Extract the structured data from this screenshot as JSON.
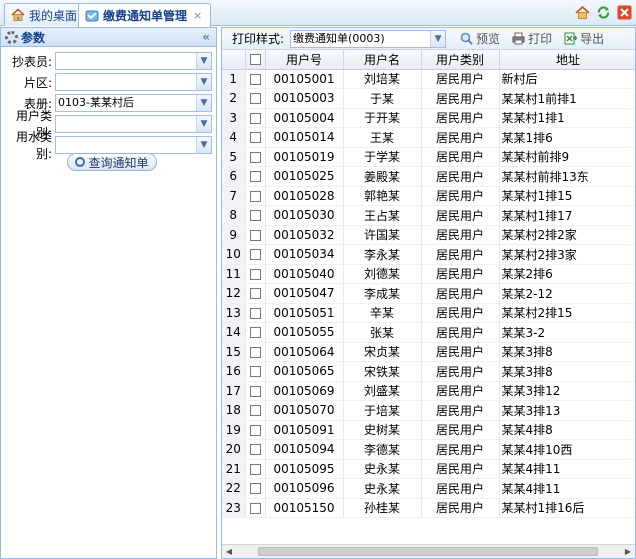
{
  "tabs": [
    {
      "label": "我的桌面",
      "active": false
    },
    {
      "label": "缴费通知单管理",
      "active": true,
      "close": "×"
    }
  ],
  "params": {
    "title": "参数",
    "fields": [
      {
        "label": "抄表员:",
        "value": ""
      },
      {
        "label": "片区:",
        "value": ""
      },
      {
        "label": "表册:",
        "value": "0103-某某村后"
      },
      {
        "label": "用户类别:",
        "value": ""
      },
      {
        "label": "用水类别:",
        "value": ""
      }
    ],
    "query_button": "查询通知单"
  },
  "toolbar": {
    "print_style_label": "打印样式:",
    "print_style_value": "缴费通知单(0003)",
    "preview": "预览",
    "print": "打印",
    "export": "导出"
  },
  "grid": {
    "columns": [
      "",
      "用户号",
      "用户名",
      "用户类别",
      "地址"
    ],
    "rows": [
      [
        "1",
        "00105001",
        "刘培某",
        "居民用户",
        "新村后"
      ],
      [
        "2",
        "00105003",
        "于某",
        "居民用户",
        "某某村1前排1"
      ],
      [
        "3",
        "00105004",
        "于开某",
        "居民用户",
        "某某村1排1"
      ],
      [
        "4",
        "00105014",
        "王某",
        "居民用户",
        "某某1排6"
      ],
      [
        "5",
        "00105019",
        "于学某",
        "居民用户",
        "某某村前排9"
      ],
      [
        "6",
        "00105025",
        "姜殿某",
        "居民用户",
        "某某村前排13东"
      ],
      [
        "7",
        "00105028",
        "郭艳某",
        "居民用户",
        "某某村1排15"
      ],
      [
        "8",
        "00105030",
        "王占某",
        "居民用户",
        "某某村1排17"
      ],
      [
        "9",
        "00105032",
        "许国某",
        "居民用户",
        "某某村2排2家"
      ],
      [
        "10",
        "00105034",
        "李永某",
        "居民用户",
        "某某村2排3家"
      ],
      [
        "11",
        "00105040",
        "刘德某",
        "居民用户",
        "某某2排6"
      ],
      [
        "12",
        "00105047",
        "李成某",
        "居民用户",
        "某某2-12"
      ],
      [
        "13",
        "00105051",
        "辛某",
        "居民用户",
        "某某村2排15"
      ],
      [
        "14",
        "00105055",
        "张某",
        "居民用户",
        "某某3-2"
      ],
      [
        "15",
        "00105064",
        "宋贞某",
        "居民用户",
        "某某3排8"
      ],
      [
        "16",
        "00105065",
        "宋铁某",
        "居民用户",
        "某某3排8"
      ],
      [
        "17",
        "00105069",
        "刘盛某",
        "居民用户",
        "某某3排12"
      ],
      [
        "18",
        "00105070",
        "于培某",
        "居民用户",
        "某某3排13"
      ],
      [
        "19",
        "00105091",
        "史树某",
        "居民用户",
        "某某4排8"
      ],
      [
        "20",
        "00105094",
        "李德某",
        "居民用户",
        "某某4排10西"
      ],
      [
        "21",
        "00105095",
        "史永某",
        "居民用户",
        "某某4排11"
      ],
      [
        "22",
        "00105096",
        "史永某",
        "居民用户",
        "某某4排11"
      ],
      [
        "23",
        "00105150",
        "孙桂某",
        "居民用户",
        "某某村1排16后"
      ]
    ]
  }
}
